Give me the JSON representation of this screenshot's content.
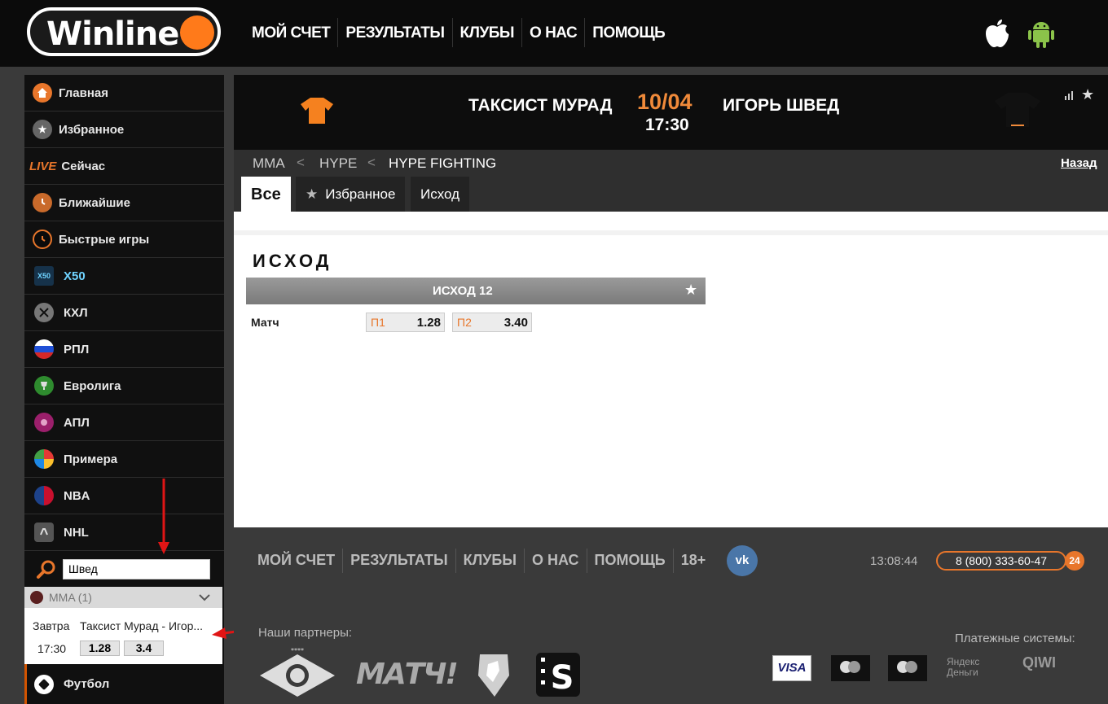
{
  "brand": {
    "logo_text": "Winline",
    "accent": "#ff7a1a"
  },
  "top_nav": [
    "МОЙ СЧЕТ",
    "РЕЗУЛЬТАТЫ",
    "КЛУБЫ",
    "О НАС",
    "ПОМОЩЬ"
  ],
  "apps": [
    "apple-icon",
    "android-icon"
  ],
  "sidebar": {
    "items": [
      {
        "label": "Главная",
        "icon": "home-icon"
      },
      {
        "label": "Избранное",
        "icon": "star-icon"
      },
      {
        "label": "Сейчас",
        "badge": "LIVE",
        "icon": "live-icon"
      },
      {
        "label": "Ближайшие",
        "icon": "clock-icon"
      },
      {
        "label": "Быстрые игры",
        "icon": "stopwatch-icon"
      },
      {
        "label": "X50",
        "icon": "x50-icon"
      },
      {
        "label": "КХЛ",
        "icon": "hockey-icon"
      },
      {
        "label": "РПЛ",
        "icon": "russia-flag-icon"
      },
      {
        "label": "Евролига",
        "icon": "euroleague-icon"
      },
      {
        "label": "АПЛ",
        "icon": "epl-icon"
      },
      {
        "label": "Примера",
        "icon": "laliga-icon"
      },
      {
        "label": "NBA",
        "icon": "nba-icon"
      },
      {
        "label": "NHL",
        "icon": "nhl-icon"
      }
    ],
    "search_value": "Швед",
    "search_result": {
      "category": "MMA (1)",
      "day": "Завтра",
      "match": "Таксист Мурад - Игор...",
      "time": "17:30",
      "odd1": "1.28",
      "odd2": "3.4"
    },
    "football": "Футбол"
  },
  "match": {
    "team1": "ТАКСИСТ МУРАД",
    "team2": "ИГОРЬ ШВЕД",
    "date": "10/04",
    "time": "17:30"
  },
  "breadcrumb": [
    "MMA",
    "HYPE",
    "HYPE FIGHTING"
  ],
  "back_label": "Назад",
  "tabs": [
    "Все",
    "Избранное",
    "Исход"
  ],
  "market": {
    "section_title": "ИСХОД",
    "table_header": "ИСХОД 12",
    "row_label": "Матч",
    "odds": [
      {
        "label": "П1",
        "value": "1.28"
      },
      {
        "label": "П2",
        "value": "3.40"
      }
    ]
  },
  "footer": {
    "nav": [
      "МОЙ СЧЕТ",
      "РЕЗУЛЬТАТЫ",
      "КЛУБЫ",
      "О НАС",
      "ПОМОЩЬ",
      "18+"
    ],
    "clock": "13:08:44",
    "phone": "8 (800) 333-60-47",
    "phone_badge": "24",
    "partners_label": "Наши партнеры:",
    "payments_label": "Платежные системы:",
    "partners": [
      "МАТЧ!"
    ],
    "payments": [
      "VISA",
      "Яндекс Деньги",
      "QIWI"
    ]
  }
}
